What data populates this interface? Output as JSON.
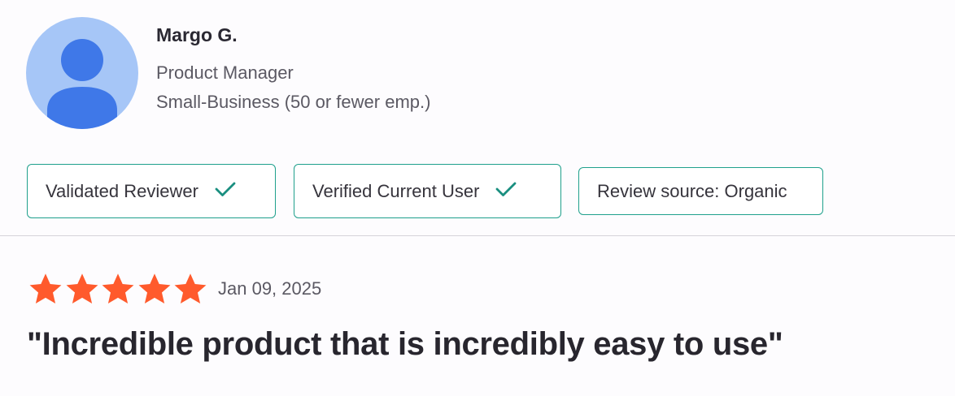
{
  "reviewer": {
    "name": "Margo G.",
    "role": "Product Manager",
    "segment": "Small-Business (50 or fewer emp.)"
  },
  "badges": [
    {
      "label": "Validated Reviewer",
      "icon": "check-icon"
    },
    {
      "label": "Verified Current User",
      "icon": "check-icon"
    },
    {
      "label": "Review source: Organic"
    }
  ],
  "review": {
    "rating": 5,
    "rating_max": 5,
    "date": "Jan 09, 2025",
    "title": "\"Incredible product that is incredibly easy to use\""
  },
  "colors": {
    "star": "#ff5a2c",
    "badge_border": "#1fa08c",
    "check": "#1a8f80",
    "avatar_bg": "#a6c6f7",
    "avatar_figure": "#3f78e8"
  }
}
